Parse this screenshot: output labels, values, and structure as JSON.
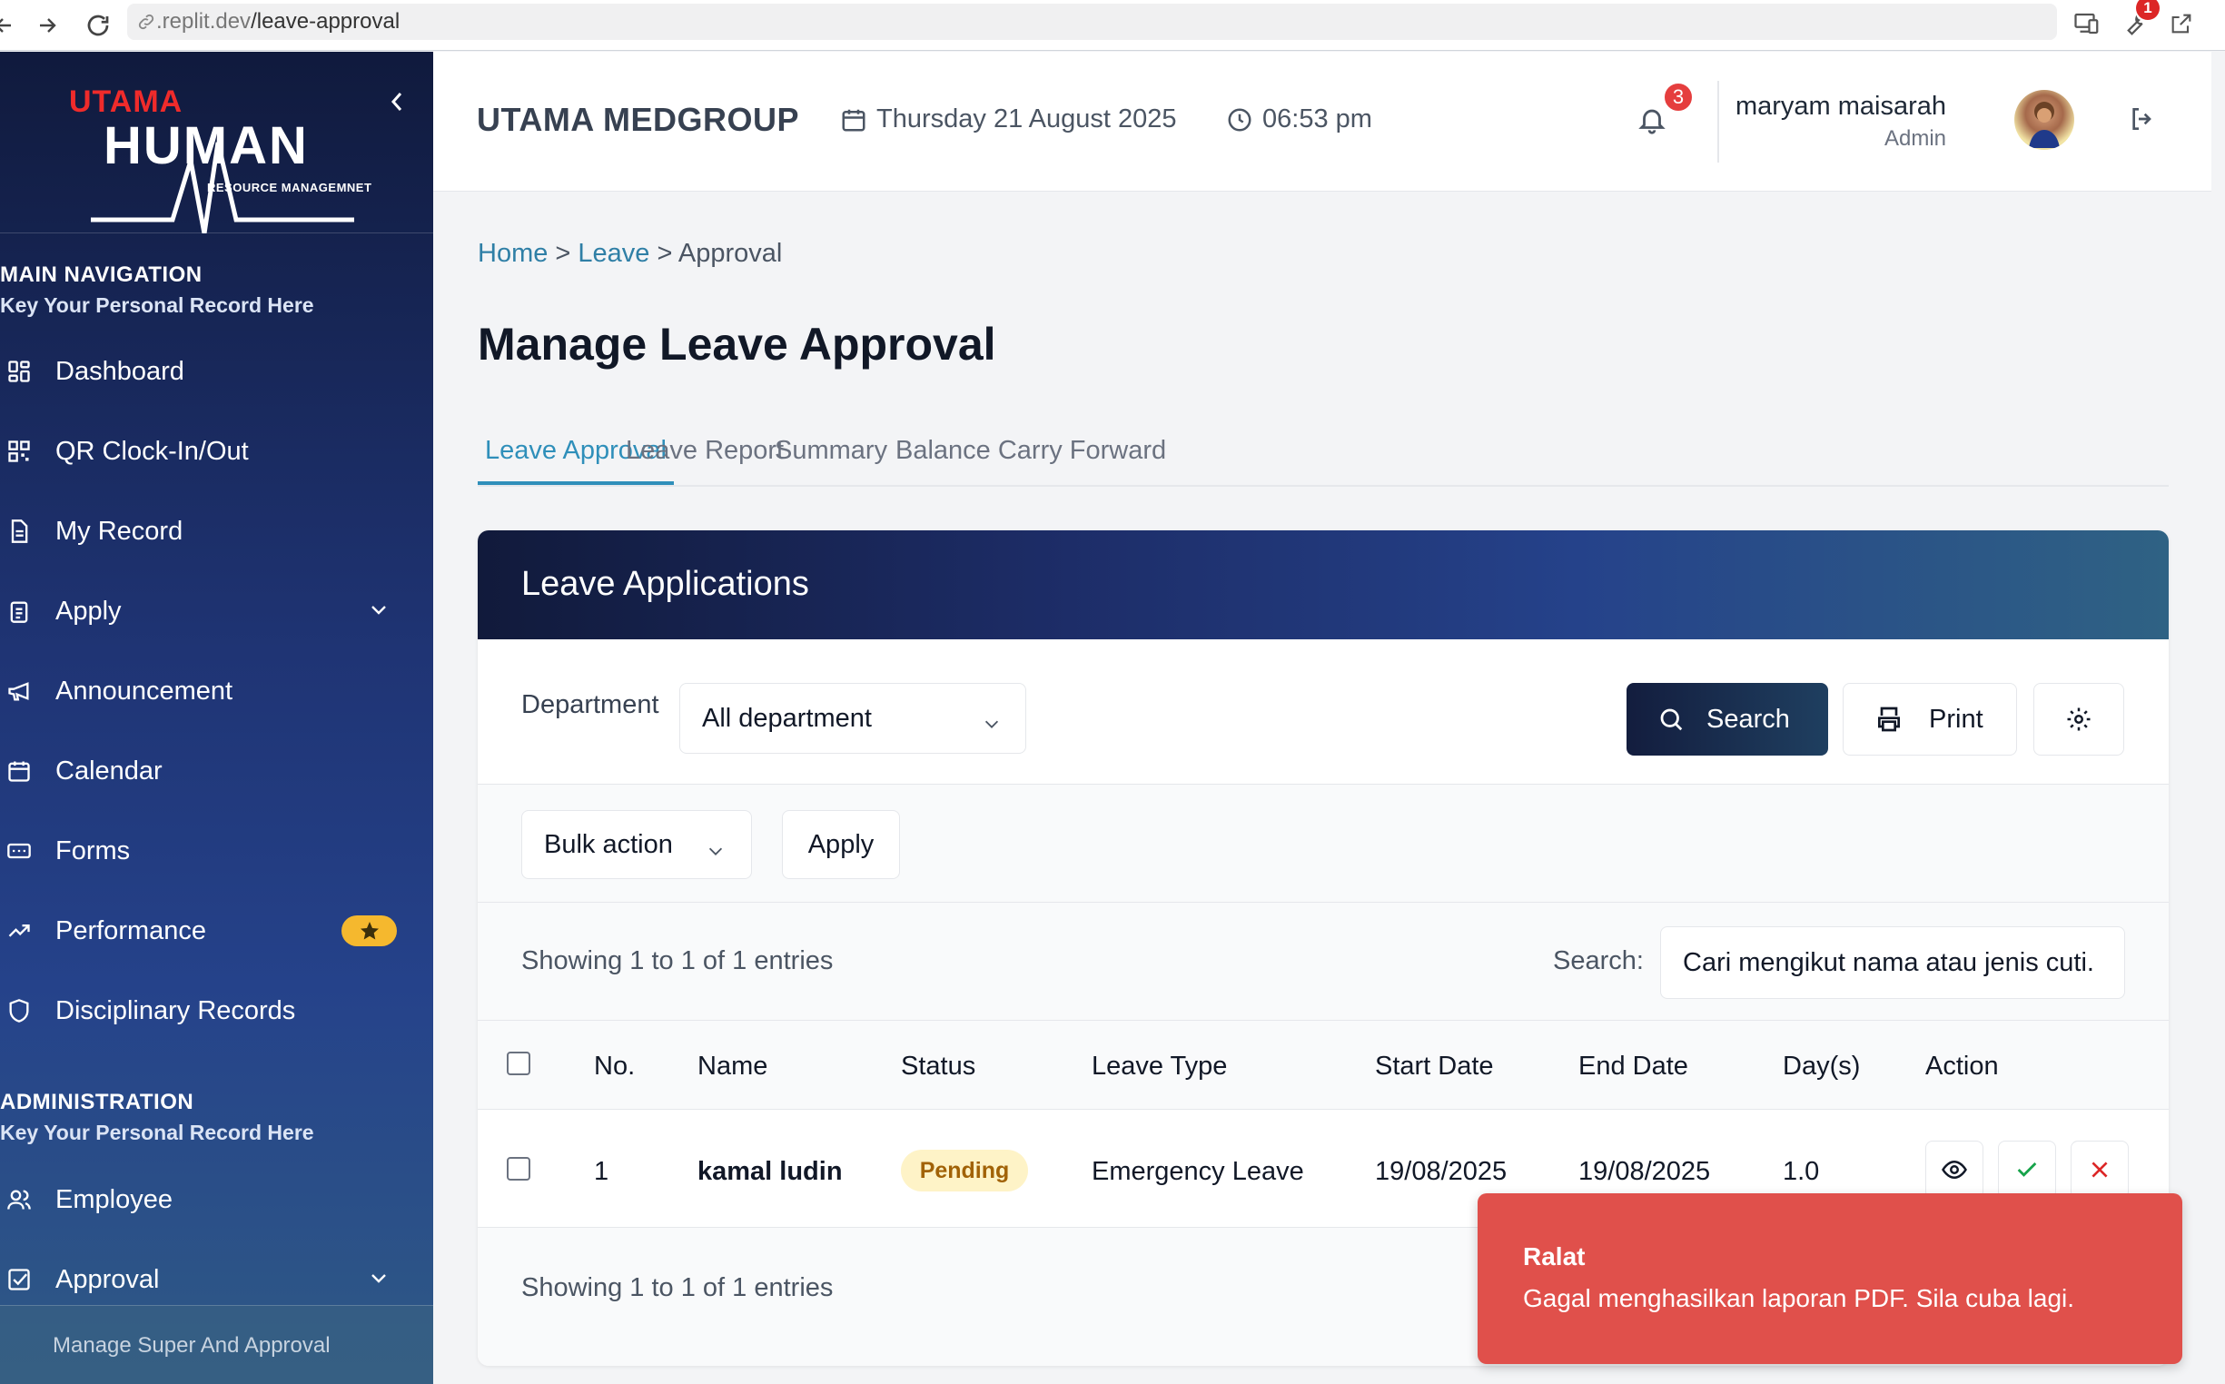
{
  "browser": {
    "url_prefix": ".replit.dev",
    "url_path": "/leave-approval",
    "extension_badge": "1"
  },
  "sidebar": {
    "logo": {
      "top": "UTAMA",
      "main": "HUMAN",
      "sub": "RESOURCE MANAGEMNET"
    },
    "main_nav": {
      "title": "MAIN NAVIGATION",
      "subtitle": "Key Your Personal Record Here"
    },
    "items": [
      {
        "label": "Dashboard",
        "icon": "dashboard-icon"
      },
      {
        "label": "QR Clock-In/Out",
        "icon": "qr-code-icon"
      },
      {
        "label": "My Record",
        "icon": "document-icon"
      },
      {
        "label": "Apply",
        "icon": "clipboard-icon",
        "expandable": true
      },
      {
        "label": "Announcement",
        "icon": "megaphone-icon"
      },
      {
        "label": "Calendar",
        "icon": "calendar-icon"
      },
      {
        "label": "Forms",
        "icon": "form-icon"
      },
      {
        "label": "Performance",
        "icon": "trending-up-icon",
        "badge": "star"
      },
      {
        "label": "Disciplinary Records",
        "icon": "shield-icon"
      }
    ],
    "admin": {
      "title": "ADMINISTRATION",
      "subtitle": "Key Your Personal Record Here"
    },
    "admin_items": [
      {
        "label": "Employee",
        "icon": "users-icon"
      },
      {
        "label": "Approval",
        "icon": "checkbox-icon",
        "expandable": true
      }
    ],
    "sub_item": "Manage Super And Approval"
  },
  "header": {
    "company": "UTAMA MEDGROUP",
    "date": "Thursday 21 August 2025",
    "time": "06:53 pm",
    "notification_count": "3",
    "user_name": "maryam maisarah",
    "user_role": "Admin"
  },
  "breadcrumb": {
    "home": "Home",
    "sep": ">",
    "leave": "Leave",
    "current": "Approval"
  },
  "page_title": "Manage Leave Approval",
  "tabs": [
    {
      "label": "Leave Approval",
      "active": true
    },
    {
      "label": "Leave Report"
    },
    {
      "label": "Summary"
    },
    {
      "label": "Balance Carry Forward"
    }
  ],
  "card": {
    "title": "Leave Applications",
    "department_label": "Department",
    "department_value": "All department",
    "search_button": "Search",
    "print_button": "Print",
    "bulk_action": "Bulk action",
    "apply_button": "Apply",
    "showing": "Showing 1 to 1 of 1 entries",
    "search_label": "Search:",
    "search_placeholder": "Cari mengikut nama atau jenis cuti.",
    "columns": [
      "No.",
      "Name",
      "Status",
      "Leave Type",
      "Start Date",
      "End Date",
      "Day(s)",
      "Action"
    ],
    "rows": [
      {
        "no": "1",
        "name": "kamal ludin",
        "status": "Pending",
        "leave_type": "Emergency Leave",
        "start": "19/08/2025",
        "end": "19/08/2025",
        "days": "1.0"
      }
    ],
    "showing_footer": "Showing 1 to 1 of 1 entries"
  },
  "toast": {
    "title": "Ralat",
    "message": "Gagal menghasilkan laporan PDF. Sila cuba lagi.",
    "color": "#e0504b"
  },
  "colors": {
    "accent": "#2f8fba",
    "sidebar_top": "#101a3d",
    "pending_bg": "#fef3c7"
  }
}
